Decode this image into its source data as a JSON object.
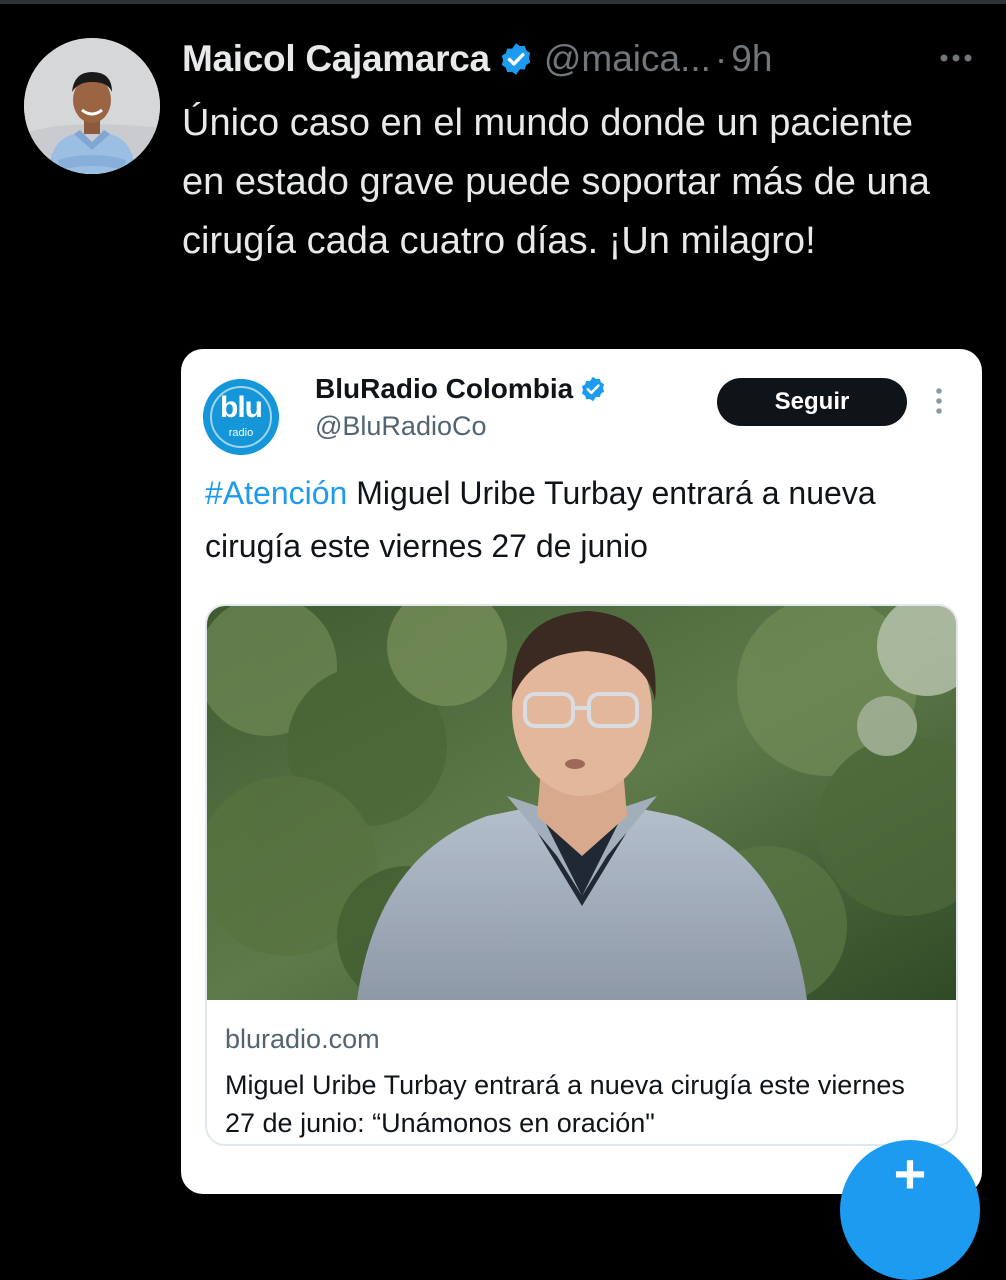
{
  "tweet": {
    "author_name": "Maicol Cajamarca",
    "handle": "@maica...",
    "separator": "·",
    "time": "9h",
    "text": "Único caso en el mundo donde un paciente en estado grave puede soportar más de una cirugía cada cuatro días. ¡Un milagro!",
    "verified_color": "#1d9bf0"
  },
  "quote": {
    "author_name": "BluRadio Colombia",
    "handle": "@BluRadioCo",
    "follow_label": "Seguir",
    "hashtag": "#Atención",
    "text": " Miguel Uribe Turbay entrará a nueva cirugía este viernes 27 de junio",
    "logo_text": "blu",
    "logo_subtext": "radio",
    "logo_color": "#1596d8"
  },
  "link_card": {
    "domain": "bluradio.com",
    "title": "Miguel Uribe Turbay entrará a nueva cirugía este viernes 27 de junio: “Unámonos en oración\""
  },
  "icons": {
    "more": "more-icon",
    "verified": "verified-badge-icon",
    "compose": "compose-plus-icon"
  },
  "fab": {
    "label": "+"
  }
}
